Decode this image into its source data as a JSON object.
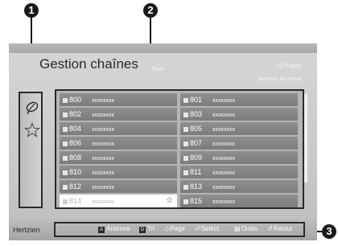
{
  "callouts": [
    "1",
    "2",
    "3"
  ],
  "header": {
    "title": "Gestion chaînes",
    "subtitle": "Tous",
    "pages": "1/2 Pages",
    "column_label": "Numéro du canal"
  },
  "sidebar": {
    "items": [
      {
        "icon": "satellite-antenna-icon"
      },
      {
        "icon": "star-outline-icon"
      }
    ]
  },
  "channels": {
    "left": [
      {
        "num": "800",
        "name": "xxxxxxxx"
      },
      {
        "num": "802",
        "name": "xxxxxxxx"
      },
      {
        "num": "804",
        "name": "xxxxxxxx"
      },
      {
        "num": "806",
        "name": "xxxxxxxx"
      },
      {
        "num": "808",
        "name": "xxxxxxxx"
      },
      {
        "num": "810",
        "name": "xxxxxxxx"
      },
      {
        "num": "812",
        "name": "xxxxxxxx"
      },
      {
        "num": "814",
        "name": "xxxxxxxx",
        "selected": true,
        "star": "☆"
      }
    ],
    "right": [
      {
        "num": "801",
        "name": "xxxxxxxx"
      },
      {
        "num": "803",
        "name": "xxxxxxxx"
      },
      {
        "num": "805",
        "name": "xxxxxxxx"
      },
      {
        "num": "807",
        "name": "xxxxxxxx"
      },
      {
        "num": "809",
        "name": "xxxxxxxx"
      },
      {
        "num": "811",
        "name": "xxxxxxxx"
      },
      {
        "num": "813",
        "name": "xxxxxxxx"
      },
      {
        "num": "815",
        "name": "xxxxxxxx"
      }
    ]
  },
  "footer": {
    "source": "Hertzien",
    "actions": [
      {
        "key": "A",
        "label": "Antenne"
      },
      {
        "key": "D",
        "label": "Tri"
      },
      {
        "icon": "◇",
        "label": "Page"
      },
      {
        "icon": "⏎",
        "label": "Seléct."
      },
      {
        "icon": "▤",
        "label": "Outils"
      },
      {
        "icon": "↺",
        "label": "Retour"
      }
    ]
  }
}
